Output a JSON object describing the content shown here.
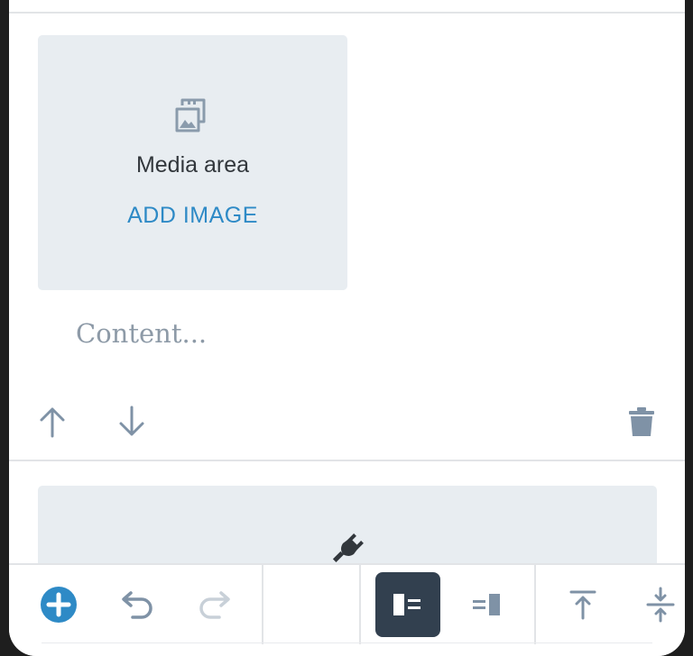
{
  "media_block": {
    "icon": "media-gallery-icon",
    "label": "Media area",
    "add_label": "ADD IMAGE"
  },
  "paragraph": {
    "placeholder": "Content..."
  },
  "block_controls": {
    "move_up_icon": "arrow-up-icon",
    "move_down_icon": "arrow-down-icon",
    "delete_icon": "trash-icon"
  },
  "unsupported_block": {
    "icon": "plug-icon"
  },
  "toolbar": {
    "add_icon": "plus-circle-icon",
    "undo_icon": "undo-icon",
    "redo_icon": "redo-icon",
    "media_left_icon": "media-left-icon",
    "media_right_icon": "media-right-icon",
    "align_top_icon": "align-top-icon",
    "align_center_icon": "align-center-icon",
    "active_tool": "media-left",
    "redo_enabled": false
  },
  "colors": {
    "accent": "#2e8ac6",
    "icon": "#7f92a6",
    "icon_disabled": "#c8d0d8",
    "block_bg": "#e8edf1",
    "active_bg": "#32404f"
  }
}
